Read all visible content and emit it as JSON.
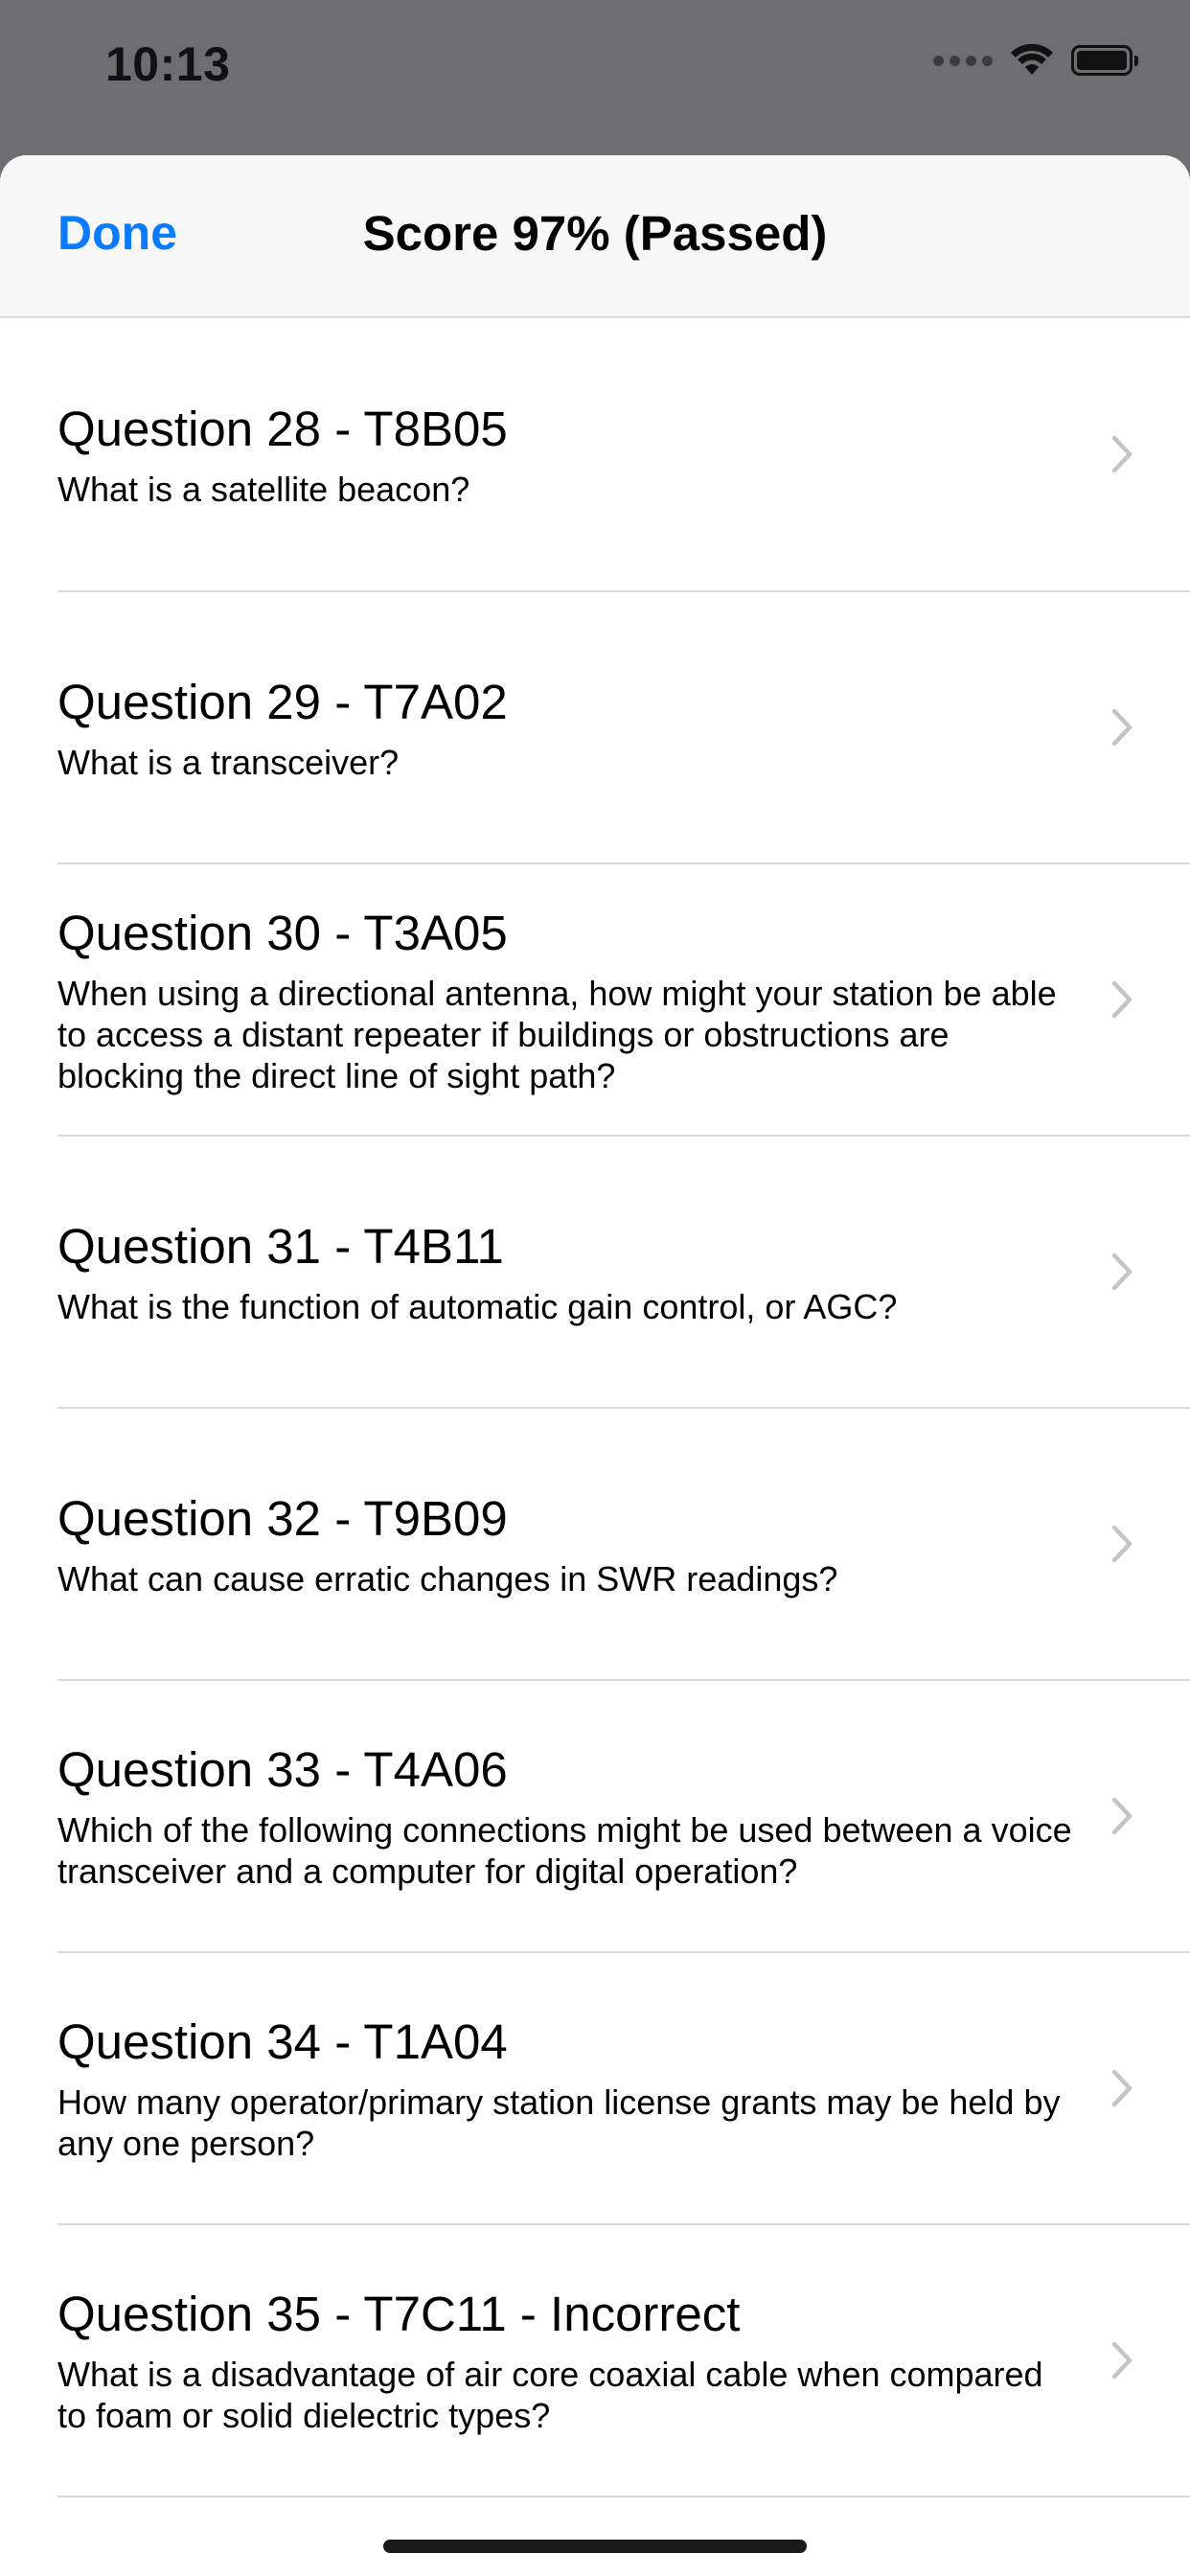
{
  "status_bar": {
    "time": "10:13"
  },
  "nav": {
    "done_label": "Done",
    "title": "Score 97% (Passed)"
  },
  "list": {
    "items": [
      {
        "title": "Question 28 - T8B05",
        "subtitle": "What is a satellite beacon?"
      },
      {
        "title": "Question 29 - T7A02",
        "subtitle": "What is a transceiver?"
      },
      {
        "title": "Question 30 - T3A05",
        "subtitle": "When using a directional antenna, how might your station be able to access a distant repeater if buildings or obstructions are blocking the direct line of sight path?"
      },
      {
        "title": "Question 31 - T4B11",
        "subtitle": "What is the function of automatic gain control, or AGC?"
      },
      {
        "title": "Question 32 - T9B09",
        "subtitle": "What can cause erratic changes in SWR readings?"
      },
      {
        "title": "Question 33 - T4A06",
        "subtitle": "Which of the following connections might be used between a voice transceiver and a computer for digital operation?"
      },
      {
        "title": "Question 34 - T1A04",
        "subtitle": "How many operator/primary station license grants may be held by any one person?"
      },
      {
        "title": "Question 35 - T7C11 - Incorrect",
        "subtitle": "What is a disadvantage of air core coaxial cable when compared to foam or solid dielectric types?"
      }
    ]
  },
  "icons": {
    "wifi": "wifi-icon",
    "battery": "battery-icon",
    "signal": "cellular-signal-icon",
    "chevron": "chevron-right-icon"
  },
  "colors": {
    "accent": "#0a7aff",
    "chevron": "#c4c4c7",
    "separator": "#d8d8dc"
  }
}
